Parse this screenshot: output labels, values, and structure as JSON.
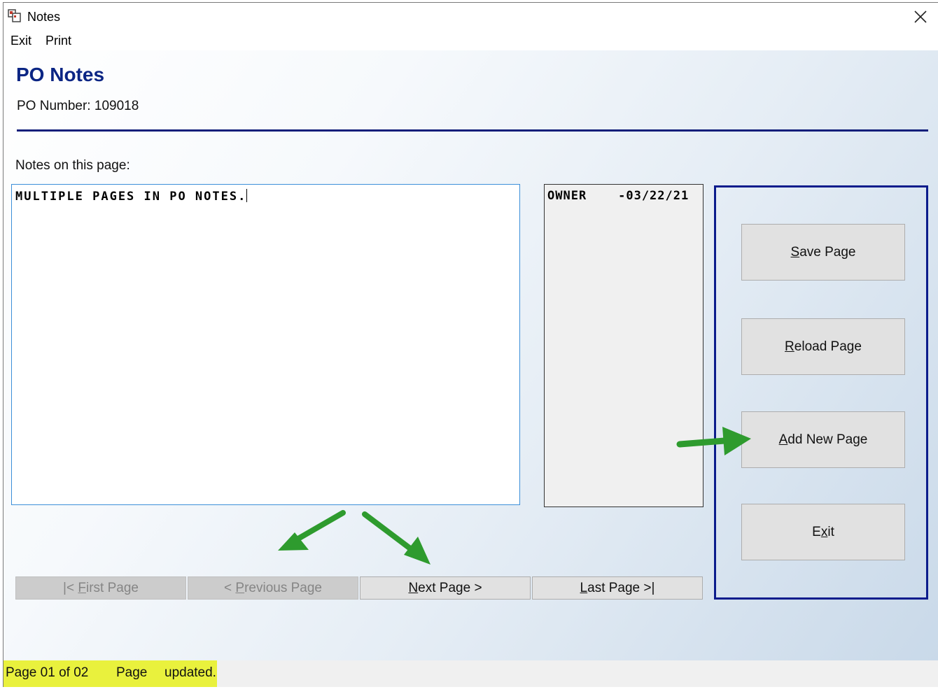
{
  "window": {
    "title": "Notes",
    "icon": "notes-app-icon",
    "close_icon": "close-icon"
  },
  "menu": {
    "items": [
      {
        "label": "Exit",
        "underline": "x"
      },
      {
        "label": "Print",
        "underline": "P"
      }
    ]
  },
  "header": {
    "title": "PO Notes",
    "po_label": "PO Number:",
    "po_number": "109018"
  },
  "notes": {
    "label": "Notes on this page:",
    "text": "MULTIPLE PAGES IN PO NOTES."
  },
  "owner": {
    "text": "OWNER    -03/22/21"
  },
  "actions": [
    {
      "pre": "",
      "key": "S",
      "post": "ave Page"
    },
    {
      "pre": "",
      "key": "R",
      "post": "eload Page"
    },
    {
      "pre": "",
      "key": "A",
      "post": "dd New Page"
    },
    {
      "pre": "E",
      "key": "x",
      "post": "it"
    }
  ],
  "navigation": [
    {
      "pre": "|< ",
      "key": "F",
      "post": "irst Page",
      "enabled": false
    },
    {
      "pre": "< ",
      "key": "P",
      "post": "revious Page",
      "enabled": false
    },
    {
      "pre": "",
      "key": "N",
      "post": "ext Page >",
      "enabled": true
    },
    {
      "pre": "",
      "key": "L",
      "post": "ast Page >|",
      "enabled": true
    }
  ],
  "status": {
    "page_indicator": "Page 01 of 02",
    "message_part1": "Page",
    "message_part2": "updated."
  },
  "colors": {
    "heading": "#0b2584",
    "panel_border": "#0b1c8c",
    "annotation_arrow": "#2e9b2e",
    "status_highlight": "#e9f13d"
  }
}
